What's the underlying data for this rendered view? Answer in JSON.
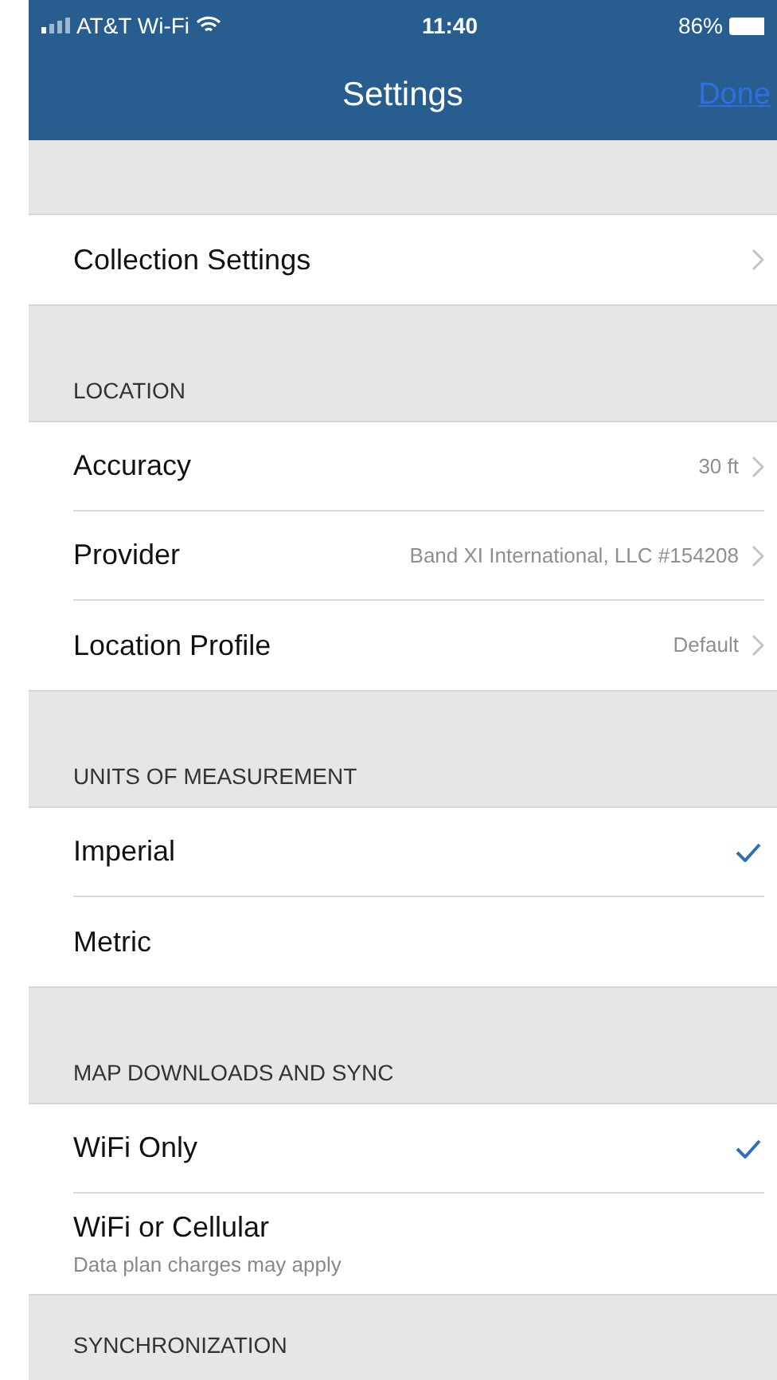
{
  "status_bar": {
    "carrier": "AT&T Wi-Fi",
    "time": "11:40",
    "battery": "86%"
  },
  "nav": {
    "title": "Settings",
    "action": "Done"
  },
  "sections": [
    {
      "rows": [
        {
          "kind": "link",
          "label": "Collection Settings"
        }
      ]
    },
    {
      "header": "LOCATION",
      "rows": [
        {
          "kind": "link",
          "label": "Accuracy",
          "value": "30 ft"
        },
        {
          "kind": "link",
          "label": "Provider",
          "value": "Band XI International, LLC #154208"
        },
        {
          "kind": "link",
          "label": "Location Profile",
          "value": "Default"
        }
      ]
    },
    {
      "header": "UNITS OF MEASUREMENT",
      "rows": [
        {
          "kind": "option",
          "label": "Imperial",
          "selected": true
        },
        {
          "kind": "option",
          "label": "Metric",
          "selected": false
        }
      ]
    },
    {
      "header": "MAP DOWNLOADS AND SYNC",
      "rows": [
        {
          "kind": "option",
          "label": "WiFi Only",
          "selected": true
        },
        {
          "kind": "option",
          "label": "WiFi or Cellular",
          "subtitle": "Data plan charges may apply",
          "selected": false
        }
      ]
    },
    {
      "header": "SYNCHRONIZATION"
    }
  ]
}
